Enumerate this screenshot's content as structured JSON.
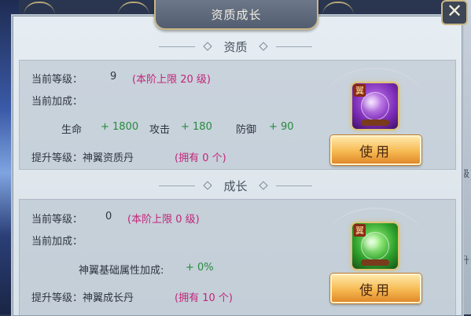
{
  "dialog": {
    "title": "资质成长",
    "close_label": "✕"
  },
  "aptitude": {
    "header": "资质",
    "level_label": "当前等级：",
    "level_value": "9",
    "level_cap": "(本阶上限 20 级)",
    "bonus_label": "当前加成：",
    "stats": [
      {
        "name": "生命",
        "value": "+ 1800"
      },
      {
        "name": "攻击",
        "value": "+ 180"
      },
      {
        "name": "防御",
        "value": "+ 90"
      }
    ],
    "upgrade_label": "提升等级：神翼资质丹",
    "owned": "(拥有 0 个)",
    "item_tag": "翼",
    "use_label": "使用"
  },
  "growth": {
    "header": "成长",
    "level_label": "当前等级：",
    "level_value": "0",
    "level_cap": "(本阶上限 0 级)",
    "bonus_label": "当前加成：",
    "attr_label": "神翼基础属性加成:",
    "attr_value": "+ 0%",
    "upgrade_label": "提升等级：神翼成长丹",
    "owned": "(拥有 10 个)",
    "item_tag": "翼",
    "use_label": "使用"
  },
  "edge_glyphs": [
    "级",
    "升"
  ],
  "colors": {
    "highlight": "#c2257a",
    "stat_value": "#278a3d",
    "button": "#f6b952"
  }
}
